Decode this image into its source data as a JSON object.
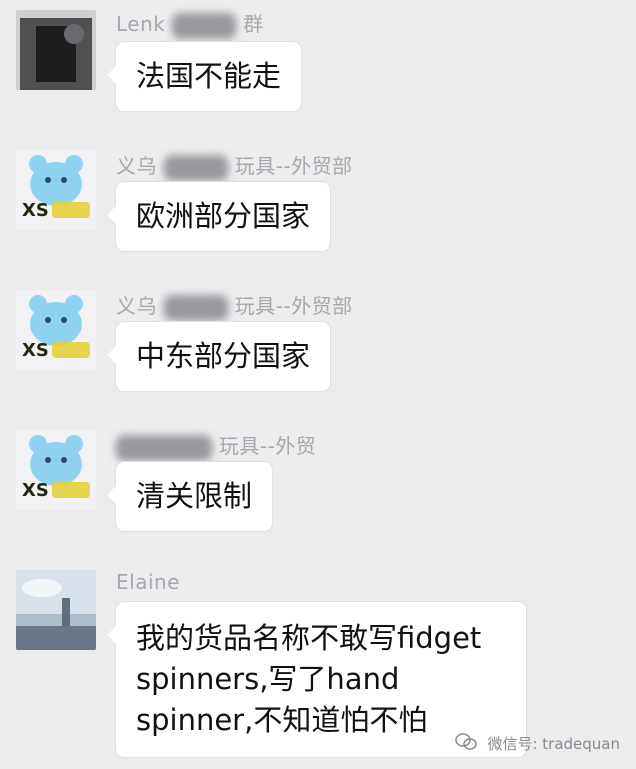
{
  "messages": [
    {
      "sender": "Lenk",
      "sender_suffix": "群",
      "text": "法国不能走",
      "avatar": "dark-photo-avatar"
    },
    {
      "sender": "义乌",
      "sender_suffix": "玩具--外贸部",
      "text": "欧洲部分国家",
      "avatar": "blue-toy-avatar"
    },
    {
      "sender": "义乌",
      "sender_suffix": "玩具--外贸部",
      "text": "中东部分国家",
      "avatar": "blue-toy-avatar"
    },
    {
      "sender": "",
      "sender_suffix": "玩具--外贸",
      "text": "清关限制",
      "avatar": "blue-toy-avatar"
    },
    {
      "sender": "Elaine",
      "sender_suffix": "",
      "text": "我的货品名称不敢写fidget spinners,写了hand spinner,不知道怕不怕",
      "avatar": "sky-photo-avatar"
    }
  ],
  "avatar_logo_text": "XS",
  "watermark": {
    "icon": "wechat-icon",
    "text": "微信号: tradequan"
  },
  "colors": {
    "background": "#ececee",
    "bubble": "#ffffff",
    "sender": "#a8a8ac",
    "toy": "#8fd3f0"
  }
}
